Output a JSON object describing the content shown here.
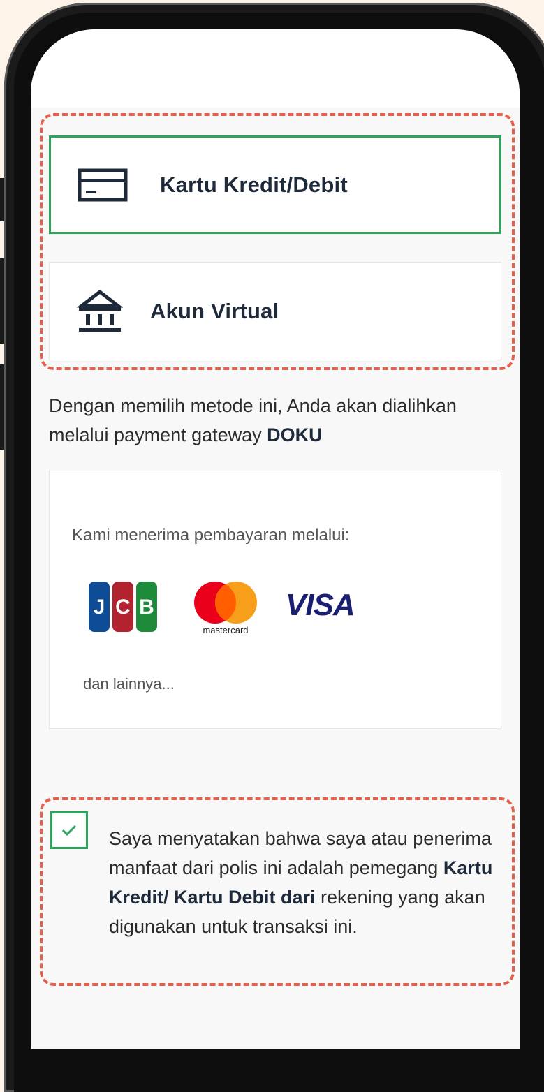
{
  "payment_methods": {
    "credit_card_label": "Kartu Kredit/Debit",
    "virtual_account_label": "Akun Virtual"
  },
  "gateway_info": {
    "text_before": "Dengan memilih metode ini, Anda akan dialihkan melalui payment gateway ",
    "gateway_name": "DOKU"
  },
  "accepted": {
    "title": "Kami menerima pembayaran melalui:",
    "jcb_letters": [
      "J",
      "C",
      "B"
    ],
    "mastercard_label": "mastercard",
    "visa_label": "VISA",
    "more": "dan lainnya..."
  },
  "consent": {
    "text_before": "Saya menyatakan bahwa saya atau penerima manfaat dari polis ini adalah pemegang ",
    "bold": "Kartu Kredit/ Kartu Debit dari",
    "text_after": " rekening yang akan digunakan untuk transaksi ini."
  },
  "colors": {
    "selected_border": "#2aa55a",
    "highlight_dash": "#e3614c",
    "text_dark": "#1e2a3a"
  },
  "icons": {
    "credit_card": "credit-card-icon",
    "bank": "bank-icon",
    "check": "checkmark-icon"
  }
}
